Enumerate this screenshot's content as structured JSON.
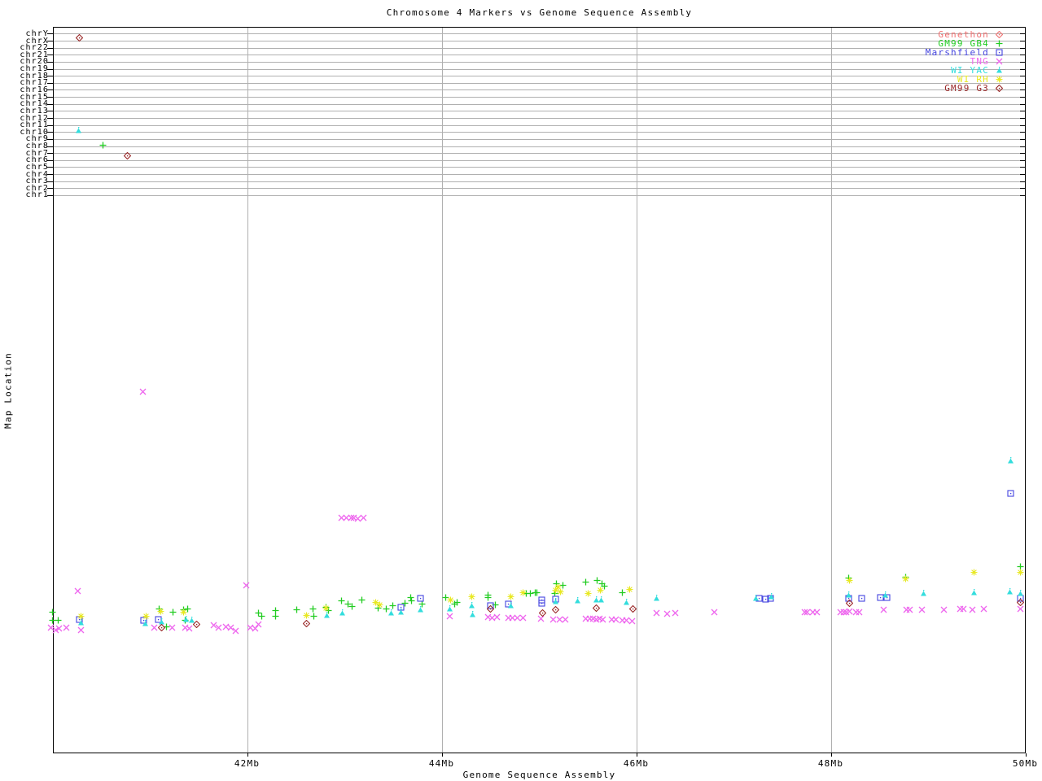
{
  "title": "Chromosome 4 Markers vs Genome Sequence Assembly",
  "x_axis": {
    "label": "Genome Sequence Assembly",
    "unit": "Mb",
    "range_mb": [
      40,
      50
    ],
    "ticks": [
      {
        "label": "42Mb",
        "mb": 42
      },
      {
        "label": "44Mb",
        "mb": 44
      },
      {
        "label": "46Mb",
        "mb": 46
      },
      {
        "label": "48Mb",
        "mb": 48
      },
      {
        "label": "50Mb",
        "mb": 50
      }
    ]
  },
  "y_axis": {
    "label": "Map Location",
    "chromosome_rows": [
      "chrY",
      "chrX",
      "chr22",
      "chr21",
      "chr20",
      "chr19",
      "chr18",
      "chr17",
      "chr16",
      "chr15",
      "chr14",
      "chr13",
      "chr12",
      "chr11",
      "chr10",
      "chr9",
      "chr8",
      "chr7",
      "chr6",
      "chr5",
      "chr4",
      "chr3",
      "chr2",
      "chr1"
    ]
  },
  "legend": {
    "position": "top-right"
  },
  "chart_data": {
    "type": "scatter",
    "title": "Chromosome 4 Markers vs Genome Sequence Assembly",
    "xlabel": "Genome Sequence Assembly",
    "ylabel": "Map Location",
    "xlim_mb": [
      40,
      50
    ],
    "grid": "gray vertical lines at 42/44/46/48 Mb; gray horizontal line per chromosome row at top",
    "note": "Each point is [x in Mb, y in screen px]. The Map-Location axis has no numeric scale; chromosome-row hits (chrY..chr1 band, y<250) and chr4 map positions (band near y 700-780) are given as measured vertical positions.",
    "series": [
      {
        "name": "Genethon",
        "symbol": "diamond",
        "color": "#f07070",
        "points": []
      },
      {
        "name": "GM99 GB4",
        "symbol": "plus",
        "color": "#22cc22",
        "points": [
          [
            40.0,
            752
          ],
          [
            40.0,
            762
          ],
          [
            40.06,
            762
          ],
          [
            40.52,
            178.5
          ],
          [
            41.1,
            748
          ],
          [
            41.17,
            770
          ],
          [
            41.24,
            752
          ],
          [
            41.35,
            749
          ],
          [
            41.39,
            748
          ],
          [
            41.36,
            762
          ],
          [
            42.12,
            753
          ],
          [
            42.15,
            757
          ],
          [
            42.29,
            750
          ],
          [
            42.29,
            757
          ],
          [
            42.51,
            749
          ],
          [
            42.68,
            748
          ],
          [
            42.69,
            757
          ],
          [
            42.81,
            746
          ],
          [
            42.84,
            750
          ],
          [
            42.97,
            738
          ],
          [
            43.04,
            742
          ],
          [
            43.08,
            745
          ],
          [
            43.18,
            737
          ],
          [
            43.35,
            747
          ],
          [
            43.43,
            748
          ],
          [
            43.5,
            744
          ],
          [
            43.62,
            741
          ],
          [
            43.68,
            734
          ],
          [
            43.69,
            738
          ],
          [
            43.8,
            742
          ],
          [
            44.04,
            734
          ],
          [
            44.13,
            742
          ],
          [
            44.16,
            740
          ],
          [
            44.48,
            731
          ],
          [
            44.48,
            734
          ],
          [
            44.55,
            743
          ],
          [
            44.87,
            729
          ],
          [
            44.91,
            729
          ],
          [
            44.96,
            728
          ],
          [
            44.98,
            728
          ],
          [
            45.16,
            729
          ],
          [
            45.18,
            717
          ],
          [
            45.25,
            719
          ],
          [
            45.48,
            715
          ],
          [
            45.6,
            713
          ],
          [
            45.65,
            717
          ],
          [
            45.67,
            720
          ],
          [
            45.86,
            728
          ],
          [
            48.18,
            710
          ],
          [
            48.77,
            709
          ],
          [
            49.95,
            696
          ]
        ]
      },
      {
        "name": "Marshfield",
        "symbol": "square",
        "color": "#4444e0",
        "points": [
          [
            40.28,
            761
          ],
          [
            40.94,
            762
          ],
          [
            41.09,
            761
          ],
          [
            43.58,
            746
          ],
          [
            43.78,
            735
          ],
          [
            44.5,
            744
          ],
          [
            44.69,
            742
          ],
          [
            45.03,
            737
          ],
          [
            45.03,
            741
          ],
          [
            45.17,
            736
          ],
          [
            47.26,
            735
          ],
          [
            47.33,
            736
          ],
          [
            47.38,
            735
          ],
          [
            48.18,
            735
          ],
          [
            48.32,
            735
          ],
          [
            48.51,
            734
          ],
          [
            48.58,
            734
          ],
          [
            49.85,
            606
          ],
          [
            49.95,
            735
          ]
        ]
      },
      {
        "name": "TNG",
        "symbol": "x",
        "color": "#ee66ee",
        "points": [
          [
            40.93,
            481
          ],
          [
            42.97,
            636
          ],
          [
            43.02,
            636
          ],
          [
            43.07,
            636
          ],
          [
            43.1,
            636
          ],
          [
            43.14,
            637
          ],
          [
            43.2,
            636
          ],
          [
            40.26,
            726
          ],
          [
            41.99,
            719
          ],
          [
            39.98,
            771
          ],
          [
            40.03,
            774
          ],
          [
            40.07,
            772
          ],
          [
            40.14,
            771
          ],
          [
            40.29,
            774
          ],
          [
            41.05,
            771
          ],
          [
            41.23,
            771
          ],
          [
            41.36,
            771
          ],
          [
            41.41,
            772
          ],
          [
            41.66,
            768
          ],
          [
            41.71,
            771
          ],
          [
            41.78,
            770
          ],
          [
            41.83,
            771
          ],
          [
            41.88,
            775
          ],
          [
            42.03,
            771
          ],
          [
            42.08,
            772
          ],
          [
            42.12,
            767
          ],
          [
            44.08,
            757
          ],
          [
            44.48,
            758
          ],
          [
            44.52,
            759
          ],
          [
            44.57,
            758
          ],
          [
            44.69,
            759
          ],
          [
            44.73,
            759
          ],
          [
            44.78,
            759
          ],
          [
            44.84,
            759
          ],
          [
            45.02,
            760
          ],
          [
            45.15,
            761
          ],
          [
            45.21,
            761
          ],
          [
            45.27,
            761
          ],
          [
            45.48,
            760
          ],
          [
            45.52,
            760
          ],
          [
            45.56,
            760
          ],
          [
            45.59,
            761
          ],
          [
            45.62,
            760
          ],
          [
            45.66,
            761
          ],
          [
            45.75,
            761
          ],
          [
            45.79,
            761
          ],
          [
            45.86,
            762
          ],
          [
            45.9,
            762
          ],
          [
            45.96,
            763
          ],
          [
            46.21,
            753
          ],
          [
            46.32,
            754
          ],
          [
            46.4,
            753
          ],
          [
            46.8,
            752
          ],
          [
            47.73,
            752
          ],
          [
            47.76,
            752
          ],
          [
            47.82,
            752
          ],
          [
            47.86,
            752
          ],
          [
            48.1,
            752
          ],
          [
            48.13,
            752
          ],
          [
            48.16,
            752
          ],
          [
            48.19,
            751
          ],
          [
            48.26,
            752
          ],
          [
            48.29,
            752
          ],
          [
            48.54,
            749
          ],
          [
            48.78,
            749
          ],
          [
            48.81,
            749
          ],
          [
            48.94,
            749
          ],
          [
            49.16,
            749
          ],
          [
            49.33,
            748
          ],
          [
            49.36,
            748
          ],
          [
            49.46,
            749
          ],
          [
            49.57,
            748
          ],
          [
            49.95,
            748
          ]
        ]
      },
      {
        "name": "WI YAC",
        "symbol": "triangle",
        "color": "#33dddd",
        "points": [
          [
            40.27,
            160
          ],
          [
            40.29,
            765
          ],
          [
            40.95,
            766
          ],
          [
            41.12,
            764
          ],
          [
            41.37,
            761
          ],
          [
            41.43,
            762
          ],
          [
            42.82,
            756
          ],
          [
            42.98,
            753
          ],
          [
            43.48,
            753
          ],
          [
            43.58,
            752
          ],
          [
            43.78,
            749
          ],
          [
            44.08,
            748
          ],
          [
            44.31,
            744
          ],
          [
            44.32,
            755
          ],
          [
            44.71,
            744
          ],
          [
            45.17,
            739
          ],
          [
            45.4,
            738
          ],
          [
            45.59,
            737
          ],
          [
            45.64,
            737
          ],
          [
            45.9,
            740
          ],
          [
            46.21,
            735
          ],
          [
            47.23,
            735
          ],
          [
            47.39,
            733
          ],
          [
            48.18,
            731
          ],
          [
            48.56,
            731
          ],
          [
            48.95,
            729
          ],
          [
            49.47,
            728
          ],
          [
            49.84,
            727
          ],
          [
            49.85,
            566
          ],
          [
            49.95,
            729
          ]
        ]
      },
      {
        "name": "WI RH",
        "symbol": "star",
        "color": "#e8e822",
        "points": [
          [
            40.29,
            757
          ],
          [
            40.96,
            757
          ],
          [
            41.11,
            751
          ],
          [
            41.35,
            752
          ],
          [
            42.61,
            756
          ],
          [
            42.81,
            747
          ],
          [
            43.32,
            740
          ],
          [
            43.36,
            743
          ],
          [
            44.09,
            737
          ],
          [
            44.31,
            733
          ],
          [
            44.71,
            733
          ],
          [
            44.84,
            728
          ],
          [
            45.2,
            721
          ],
          [
            45.17,
            725
          ],
          [
            45.22,
            727
          ],
          [
            45.51,
            729
          ],
          [
            45.63,
            725
          ],
          [
            45.93,
            724
          ],
          [
            48.19,
            713
          ],
          [
            48.77,
            711
          ],
          [
            49.47,
            703
          ],
          [
            49.95,
            703
          ]
        ]
      },
      {
        "name": "GM99 G3",
        "symbol": "diamond",
        "color": "#992626",
        "points": [
          [
            40.28,
            46.5
          ],
          [
            40.77,
            191
          ],
          [
            41.12,
            771
          ],
          [
            41.48,
            767
          ],
          [
            42.61,
            766
          ],
          [
            44.5,
            748
          ],
          [
            45.04,
            753
          ],
          [
            45.17,
            749
          ],
          [
            45.59,
            747
          ],
          [
            45.97,
            748
          ],
          [
            48.19,
            741
          ],
          [
            49.95,
            740
          ]
        ]
      }
    ]
  }
}
